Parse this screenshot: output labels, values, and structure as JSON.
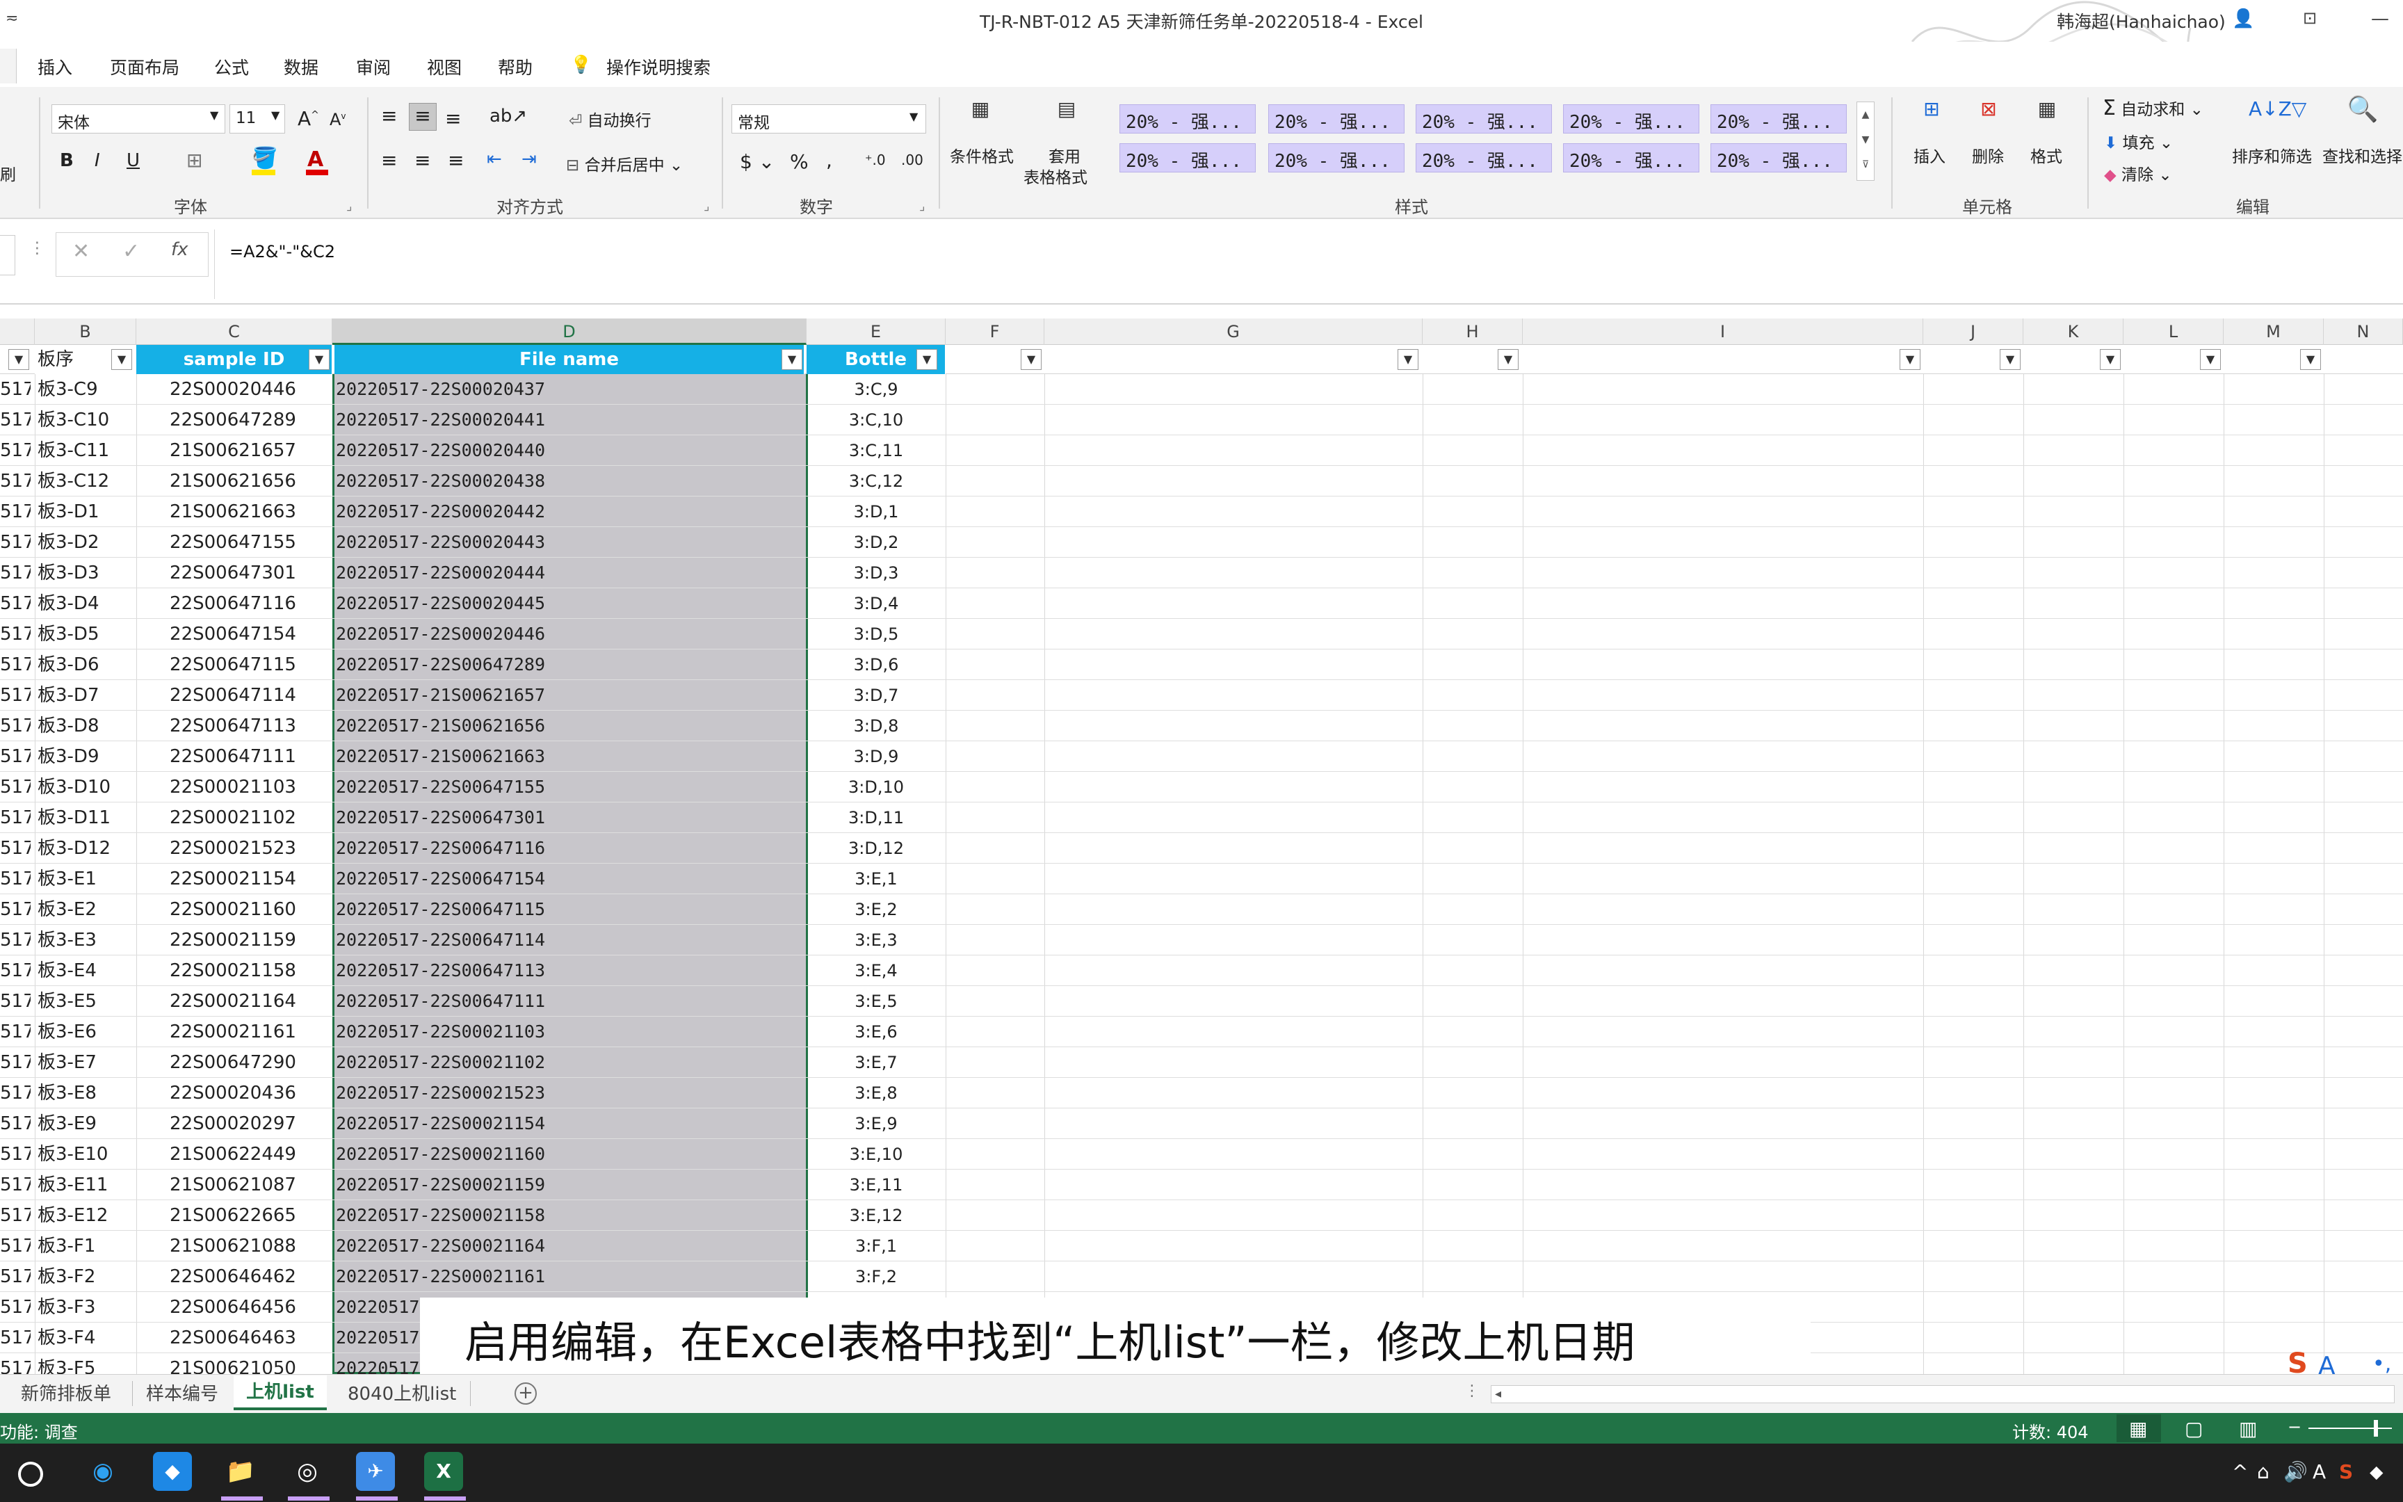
{
  "window": {
    "title": "TJ-R-NBT-012 A5 天津新筛任务单-20220518-4  -  Excel",
    "user": "韩海超(Hanhaichao)"
  },
  "menu": {
    "items": [
      "插入",
      "页面布局",
      "公式",
      "数据",
      "审阅",
      "视图",
      "帮助"
    ],
    "tell_me": "操作说明搜索"
  },
  "ribbon": {
    "font_name": "宋体",
    "font_size": "11",
    "font_group": "字体",
    "wrap_text": "自动换行",
    "merge_center": "合并后居中",
    "align_group": "对齐方式",
    "number_format": "常规",
    "number_group": "数字",
    "cond_format": "条件格式",
    "table_format_1": "套用",
    "table_format_2": "表格格式",
    "style_cells": [
      "20% - 强...",
      "20% - 强...",
      "20% - 强...",
      "20% - 强...",
      "20% - 强...",
      "20% - 强...",
      "20% - 强...",
      "20% - 强...",
      "20% - 强...",
      "20% - 强..."
    ],
    "styles_group": "样式",
    "insert": "插入",
    "delete": "删除",
    "format": "格式",
    "cells_group": "单元格",
    "autosum": "自动求和",
    "fill": "填充",
    "clear": "清除",
    "sort_filter": "排序和筛选",
    "find_select": "查找和选择",
    "edit_group": "编辑",
    "left_stub": "刷"
  },
  "formula_bar": {
    "formula": "=A2&\"-\"&C2"
  },
  "columns": [
    "B",
    "C",
    "D",
    "E",
    "F",
    "G",
    "H",
    "I",
    "J",
    "K",
    "L",
    "M",
    "N"
  ],
  "table_headers": {
    "b": "板序",
    "c": "sample ID",
    "d": "File name",
    "e": "Bottle"
  },
  "rows": [
    {
      "a": "517",
      "b": "板3-C9",
      "c": "22S00020446",
      "d": "20220517-22S00020437",
      "e": "3:C,9"
    },
    {
      "a": "517",
      "b": "板3-C10",
      "c": "22S00647289",
      "d": "20220517-22S00020441",
      "e": "3:C,10"
    },
    {
      "a": "517",
      "b": "板3-C11",
      "c": "21S00621657",
      "d": "20220517-22S00020440",
      "e": "3:C,11"
    },
    {
      "a": "517",
      "b": "板3-C12",
      "c": "21S00621656",
      "d": "20220517-22S00020438",
      "e": "3:C,12"
    },
    {
      "a": "517",
      "b": "板3-D1",
      "c": "21S00621663",
      "d": "20220517-22S00020442",
      "e": "3:D,1"
    },
    {
      "a": "517",
      "b": "板3-D2",
      "c": "22S00647155",
      "d": "20220517-22S00020443",
      "e": "3:D,2"
    },
    {
      "a": "517",
      "b": "板3-D3",
      "c": "22S00647301",
      "d": "20220517-22S00020444",
      "e": "3:D,3"
    },
    {
      "a": "517",
      "b": "板3-D4",
      "c": "22S00647116",
      "d": "20220517-22S00020445",
      "e": "3:D,4"
    },
    {
      "a": "517",
      "b": "板3-D5",
      "c": "22S00647154",
      "d": "20220517-22S00020446",
      "e": "3:D,5"
    },
    {
      "a": "517",
      "b": "板3-D6",
      "c": "22S00647115",
      "d": "20220517-22S00647289",
      "e": "3:D,6"
    },
    {
      "a": "517",
      "b": "板3-D7",
      "c": "22S00647114",
      "d": "20220517-21S00621657",
      "e": "3:D,7"
    },
    {
      "a": "517",
      "b": "板3-D8",
      "c": "22S00647113",
      "d": "20220517-21S00621656",
      "e": "3:D,8"
    },
    {
      "a": "517",
      "b": "板3-D9",
      "c": "22S00647111",
      "d": "20220517-21S00621663",
      "e": "3:D,9"
    },
    {
      "a": "517",
      "b": "板3-D10",
      "c": "22S00021103",
      "d": "20220517-22S00647155",
      "e": "3:D,10"
    },
    {
      "a": "517",
      "b": "板3-D11",
      "c": "22S00021102",
      "d": "20220517-22S00647301",
      "e": "3:D,11"
    },
    {
      "a": "517",
      "b": "板3-D12",
      "c": "22S00021523",
      "d": "20220517-22S00647116",
      "e": "3:D,12"
    },
    {
      "a": "517",
      "b": "板3-E1",
      "c": "22S00021154",
      "d": "20220517-22S00647154",
      "e": "3:E,1"
    },
    {
      "a": "517",
      "b": "板3-E2",
      "c": "22S00021160",
      "d": "20220517-22S00647115",
      "e": "3:E,2"
    },
    {
      "a": "517",
      "b": "板3-E3",
      "c": "22S00021159",
      "d": "20220517-22S00647114",
      "e": "3:E,3"
    },
    {
      "a": "517",
      "b": "板3-E4",
      "c": "22S00021158",
      "d": "20220517-22S00647113",
      "e": "3:E,4"
    },
    {
      "a": "517",
      "b": "板3-E5",
      "c": "22S00021164",
      "d": "20220517-22S00647111",
      "e": "3:E,5"
    },
    {
      "a": "517",
      "b": "板3-E6",
      "c": "22S00021161",
      "d": "20220517-22S00021103",
      "e": "3:E,6"
    },
    {
      "a": "517",
      "b": "板3-E7",
      "c": "22S00647290",
      "d": "20220517-22S00021102",
      "e": "3:E,7"
    },
    {
      "a": "517",
      "b": "板3-E8",
      "c": "22S00020436",
      "d": "20220517-22S00021523",
      "e": "3:E,8"
    },
    {
      "a": "517",
      "b": "板3-E9",
      "c": "22S00020297",
      "d": "20220517-22S00021154",
      "e": "3:E,9"
    },
    {
      "a": "517",
      "b": "板3-E10",
      "c": "21S00622449",
      "d": "20220517-22S00021160",
      "e": "3:E,10"
    },
    {
      "a": "517",
      "b": "板3-E11",
      "c": "21S00621087",
      "d": "20220517-22S00021159",
      "e": "3:E,11"
    },
    {
      "a": "517",
      "b": "板3-E12",
      "c": "21S00622665",
      "d": "20220517-22S00021158",
      "e": "3:E,12"
    },
    {
      "a": "517",
      "b": "板3-F1",
      "c": "21S00621088",
      "d": "20220517-22S00021164",
      "e": "3:F,1"
    },
    {
      "a": "517",
      "b": "板3-F2",
      "c": "22S00646462",
      "d": "20220517-22S00021161",
      "e": "3:F,2"
    },
    {
      "a": "517",
      "b": "板3-F3",
      "c": "22S00646456",
      "d": "20220517",
      "e": ""
    },
    {
      "a": "517",
      "b": "板3-F4",
      "c": "22S00646463",
      "d": "20220517",
      "e": ""
    },
    {
      "a": "517",
      "b": "板3-F5",
      "c": "21S00621050",
      "d": "20220517",
      "e": ""
    }
  ],
  "subtitle": "启用编辑，在Excel表格中找到“上机list”一栏，修改上机日期",
  "sheet_tabs": {
    "tab1": "新筛排板单",
    "tab2": "样本编号",
    "active": "上机list",
    "tab4": "8040上机list"
  },
  "status": {
    "left": "功能: 调查",
    "count": "计数: 404"
  },
  "colors": {
    "excel_green": "#217346",
    "header_blue": "#15b0e6",
    "style_purple": "#d6cffa",
    "selection_gray": "#c8c6cb"
  }
}
